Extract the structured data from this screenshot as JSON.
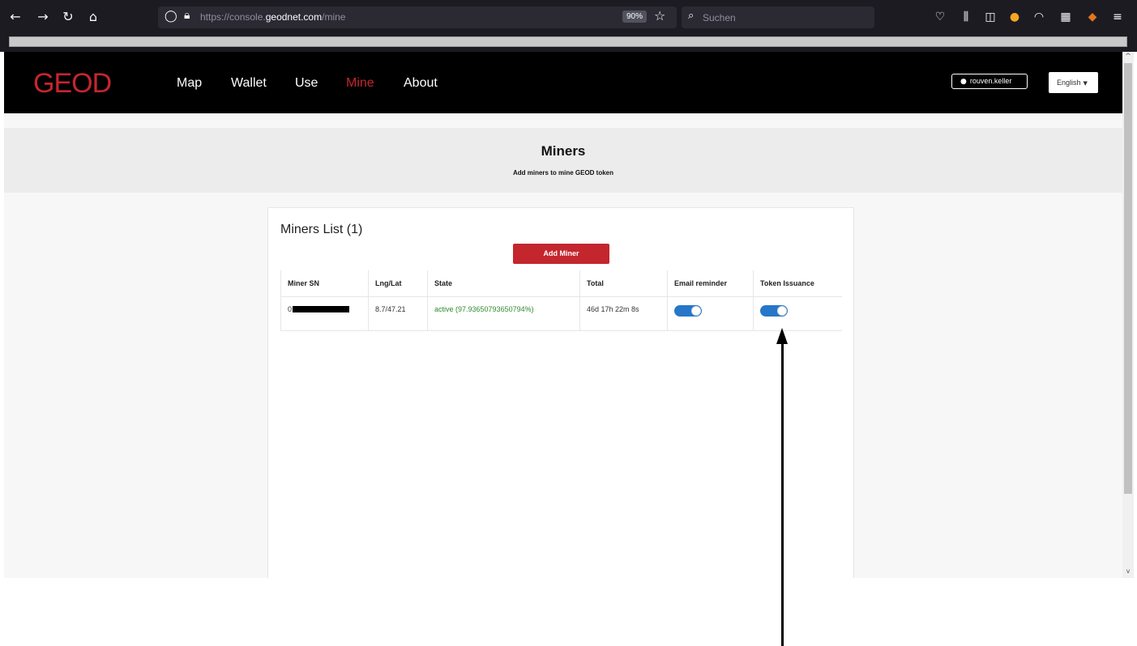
{
  "browser": {
    "url_prefix": "https://console.",
    "url_domain": "geodnet.com",
    "url_path": "/mine",
    "zoom": "90%",
    "search_placeholder": "Suchen",
    "icons": [
      "back-icon",
      "forward-icon",
      "reload-icon",
      "home-icon",
      "shield-icon",
      "lock-icon",
      "star-icon",
      "search-icon",
      "pocket-icon",
      "library-icon",
      "reader-icon",
      "extension-icon",
      "profile-icon",
      "extensions-badge-icon",
      "metamask-icon",
      "menu-icon"
    ]
  },
  "header": {
    "logo": "GEOD",
    "nav": [
      {
        "label": "Map",
        "active": false
      },
      {
        "label": "Wallet",
        "active": false
      },
      {
        "label": "Use",
        "active": false
      },
      {
        "label": "Mine",
        "active": true
      },
      {
        "label": "About",
        "active": false
      }
    ],
    "user": "rouven.keller",
    "language": "English"
  },
  "hero": {
    "title": "Miners",
    "subtitle": "Add miners to mine GEOD token"
  },
  "card": {
    "title": "Miners List (1)",
    "add_button": "Add Miner",
    "columns": [
      "Miner SN",
      "Lng/Lat",
      "State",
      "Total",
      "Email reminder",
      "Token Issuance"
    ],
    "rows": [
      {
        "miner_sn": "0",
        "lnglat": "8.7/47.21",
        "state": "active (97.93650793650794%)",
        "total": "46d 17h 22m 8s",
        "email_reminder": true,
        "token_issuance": true
      }
    ]
  },
  "colors": {
    "brand_red": "#c4262e",
    "toggle_blue": "#2677c9",
    "state_green": "#2e8b2e"
  }
}
